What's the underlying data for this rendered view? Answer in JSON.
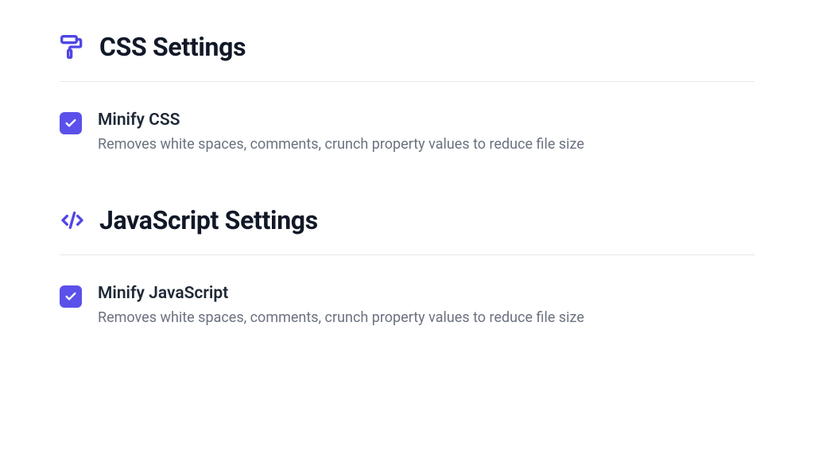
{
  "sections": {
    "css": {
      "title": "CSS Settings",
      "settings": {
        "minify": {
          "label": "Minify CSS",
          "description": "Removes white spaces, comments, crunch property values to reduce file size",
          "checked": true
        }
      }
    },
    "javascript": {
      "title": "JavaScript Settings",
      "settings": {
        "minify": {
          "label": "Minify JavaScript",
          "description": "Removes white spaces, comments, crunch property values to reduce file size",
          "checked": true
        }
      }
    }
  }
}
